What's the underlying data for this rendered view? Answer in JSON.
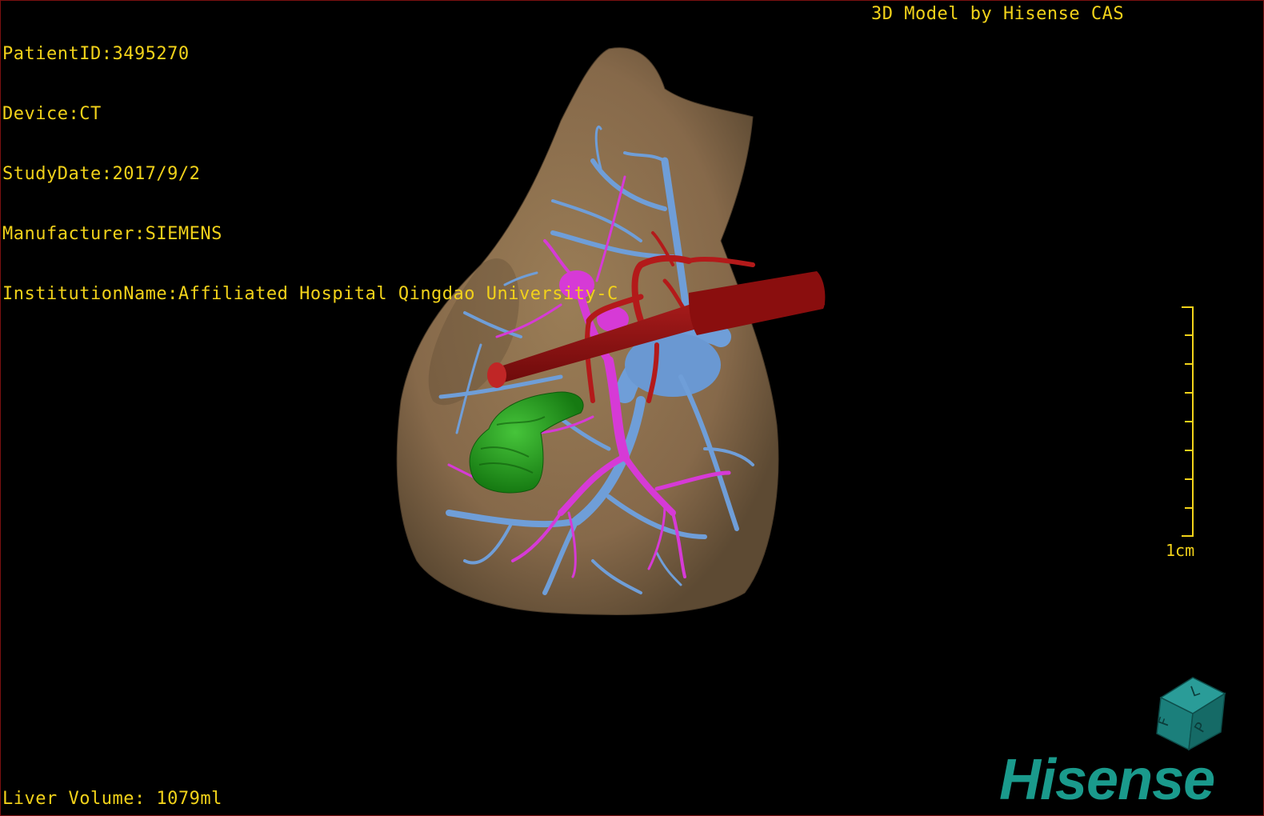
{
  "patient_info": [
    "PatientID:3495270",
    "Device:CT",
    "StudyDate:2017/9/2",
    "Manufacturer:SIEMENS",
    "InstitutionName:Affiliated Hospital Qingdao University-C"
  ],
  "header_right": "3D Model by Hisense CAS",
  "liver_volume": "Liver Volume: 1079ml",
  "scale": {
    "label": "1cm"
  },
  "orientation_cube": {
    "labels": [
      "F",
      "L",
      "P"
    ]
  },
  "logo_text": "Hisense",
  "colors": {
    "overlay_text": "#f2d21a",
    "liver": "#8a6d4a",
    "portal_vein": "#6f9ed8",
    "hepatic_vein": "#d63ad6",
    "artery": "#a31414",
    "lesion": "#22a01e",
    "brand": "#1a9a8c"
  },
  "model_parts": [
    "liver",
    "portal-vein",
    "hepatic-vein",
    "hepatic-artery",
    "vena-cava",
    "lesion"
  ]
}
